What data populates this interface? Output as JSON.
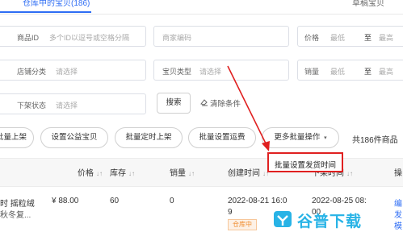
{
  "tabs": {
    "active": "仓库中的宝贝(186)",
    "draft": "草稿宝贝"
  },
  "filters": {
    "product_id": {
      "label": "商品ID",
      "placeholder": "多个ID以逗号或空格分隔"
    },
    "merchant_code": {
      "placeholder": "商家编码"
    },
    "price": {
      "label": "价格",
      "low": "最低",
      "to": "至",
      "high": "最高"
    },
    "store_category": {
      "label": "店铺分类",
      "placeholder": "请选择"
    },
    "item_type": {
      "label": "宝贝类型",
      "placeholder": "请选择"
    },
    "sales": {
      "label": "销量",
      "low": "最低",
      "to": "至",
      "high": "最高"
    },
    "delist_status": {
      "label": "下架状态",
      "placeholder": "请选择"
    }
  },
  "actions": {
    "search": "搜索",
    "clear": "清除条件",
    "batch_list": "批量上架",
    "set_public": "设置公益宝贝",
    "batch_schedule": "批量定时上架",
    "batch_shipping": "批量设置运费",
    "more_batch": "更多批量操作",
    "total": "共186件商品",
    "dropdown_item": "批量设置发货时间"
  },
  "table": {
    "headers": {
      "price": "价格",
      "stock": "库存",
      "sales": "销量",
      "created": "创建时间",
      "delisted": "下架时间",
      "ops": "操"
    },
    "row": {
      "title_line1": "时 摇粒绒",
      "title_line2": "秋冬复...",
      "price": "¥ 88.00",
      "stock": "60",
      "sales": "0",
      "created_line1": "2022-08-21 16:0",
      "created_line2": "9",
      "delisted_line1": "2022-08-25 08:",
      "delisted_line2": "00",
      "status": "仓库中",
      "ops": [
        "编",
        "发",
        "模"
      ]
    }
  },
  "watermark": {
    "text": "谷普下载"
  },
  "colors": {
    "accent": "#2e6df4",
    "highlight": "#e02020",
    "status": "#f08c2e"
  }
}
